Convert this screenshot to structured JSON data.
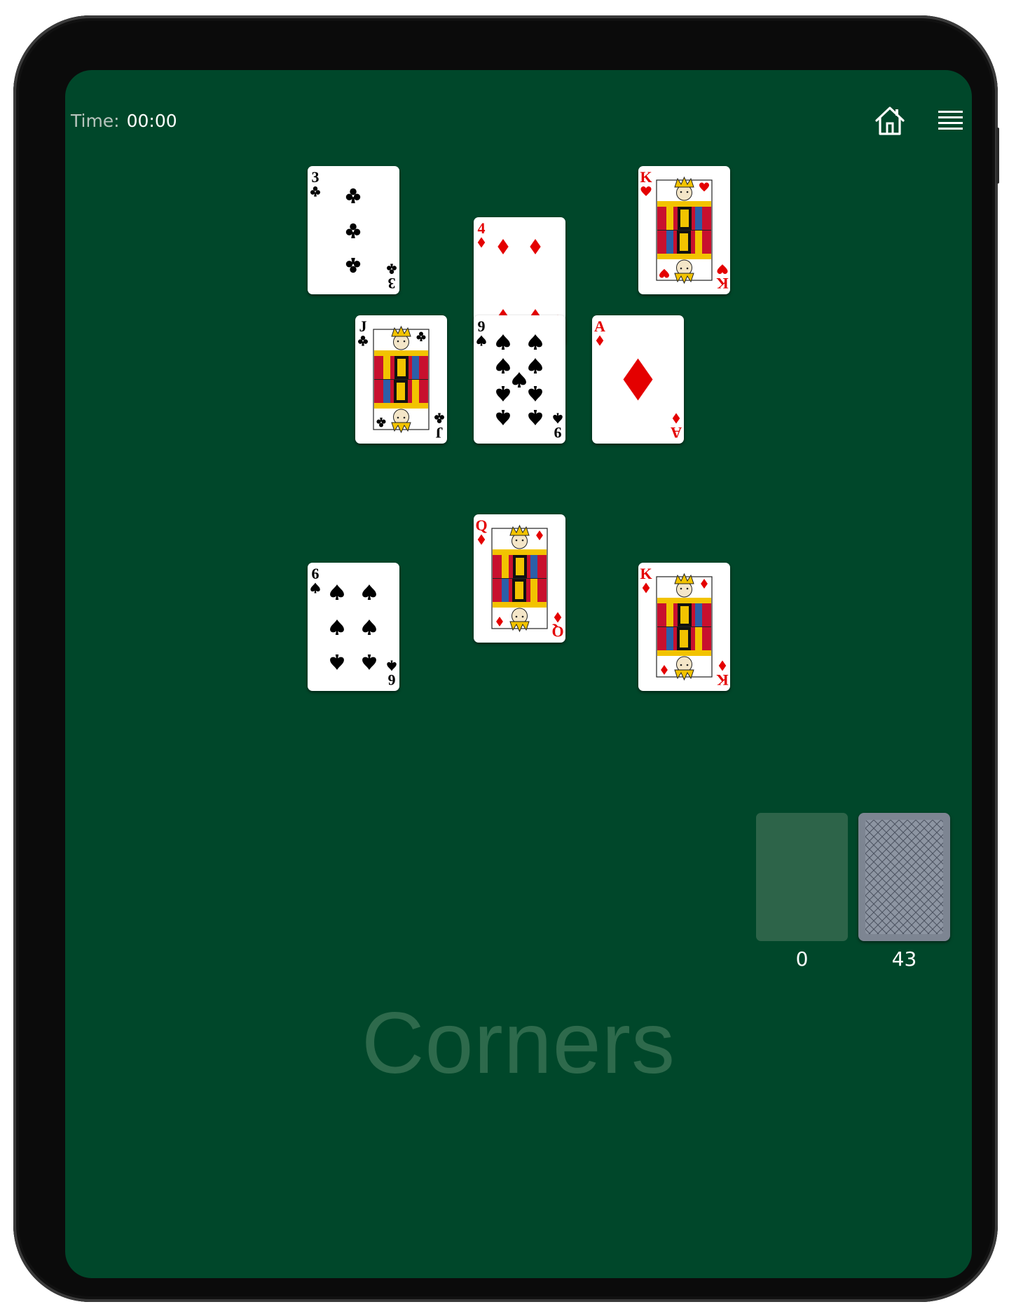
{
  "header": {
    "time_label": "Time:",
    "time_value": "00:00",
    "home_icon": "home-icon",
    "menu_icon": "hamburger-menu-icon"
  },
  "tableau": [
    {
      "rank": "3",
      "suit": "clubs",
      "color": "#000000"
    },
    {
      "rank": "4",
      "suit": "diamonds",
      "color": "#e40000"
    },
    {
      "rank": "K",
      "suit": "hearts",
      "color": "#e40000"
    },
    {
      "rank": "J",
      "suit": "clubs",
      "color": "#000000"
    },
    {
      "rank": "9",
      "suit": "spades",
      "color": "#000000"
    },
    {
      "rank": "A",
      "suit": "diamonds",
      "color": "#e40000"
    },
    {
      "rank": "Q",
      "suit": "diamonds",
      "color": "#e40000"
    },
    {
      "rank": "6",
      "suit": "spades",
      "color": "#000000"
    },
    {
      "rank": "K",
      "suit": "diamonds",
      "color": "#e40000"
    }
  ],
  "waste": {
    "count": "0"
  },
  "stock": {
    "count": "43"
  },
  "game_title": "Corners",
  "colors": {
    "felt": "#00472a",
    "placeholder": "#2d6449",
    "card_back": "#7d8592",
    "red": "#e40000"
  }
}
